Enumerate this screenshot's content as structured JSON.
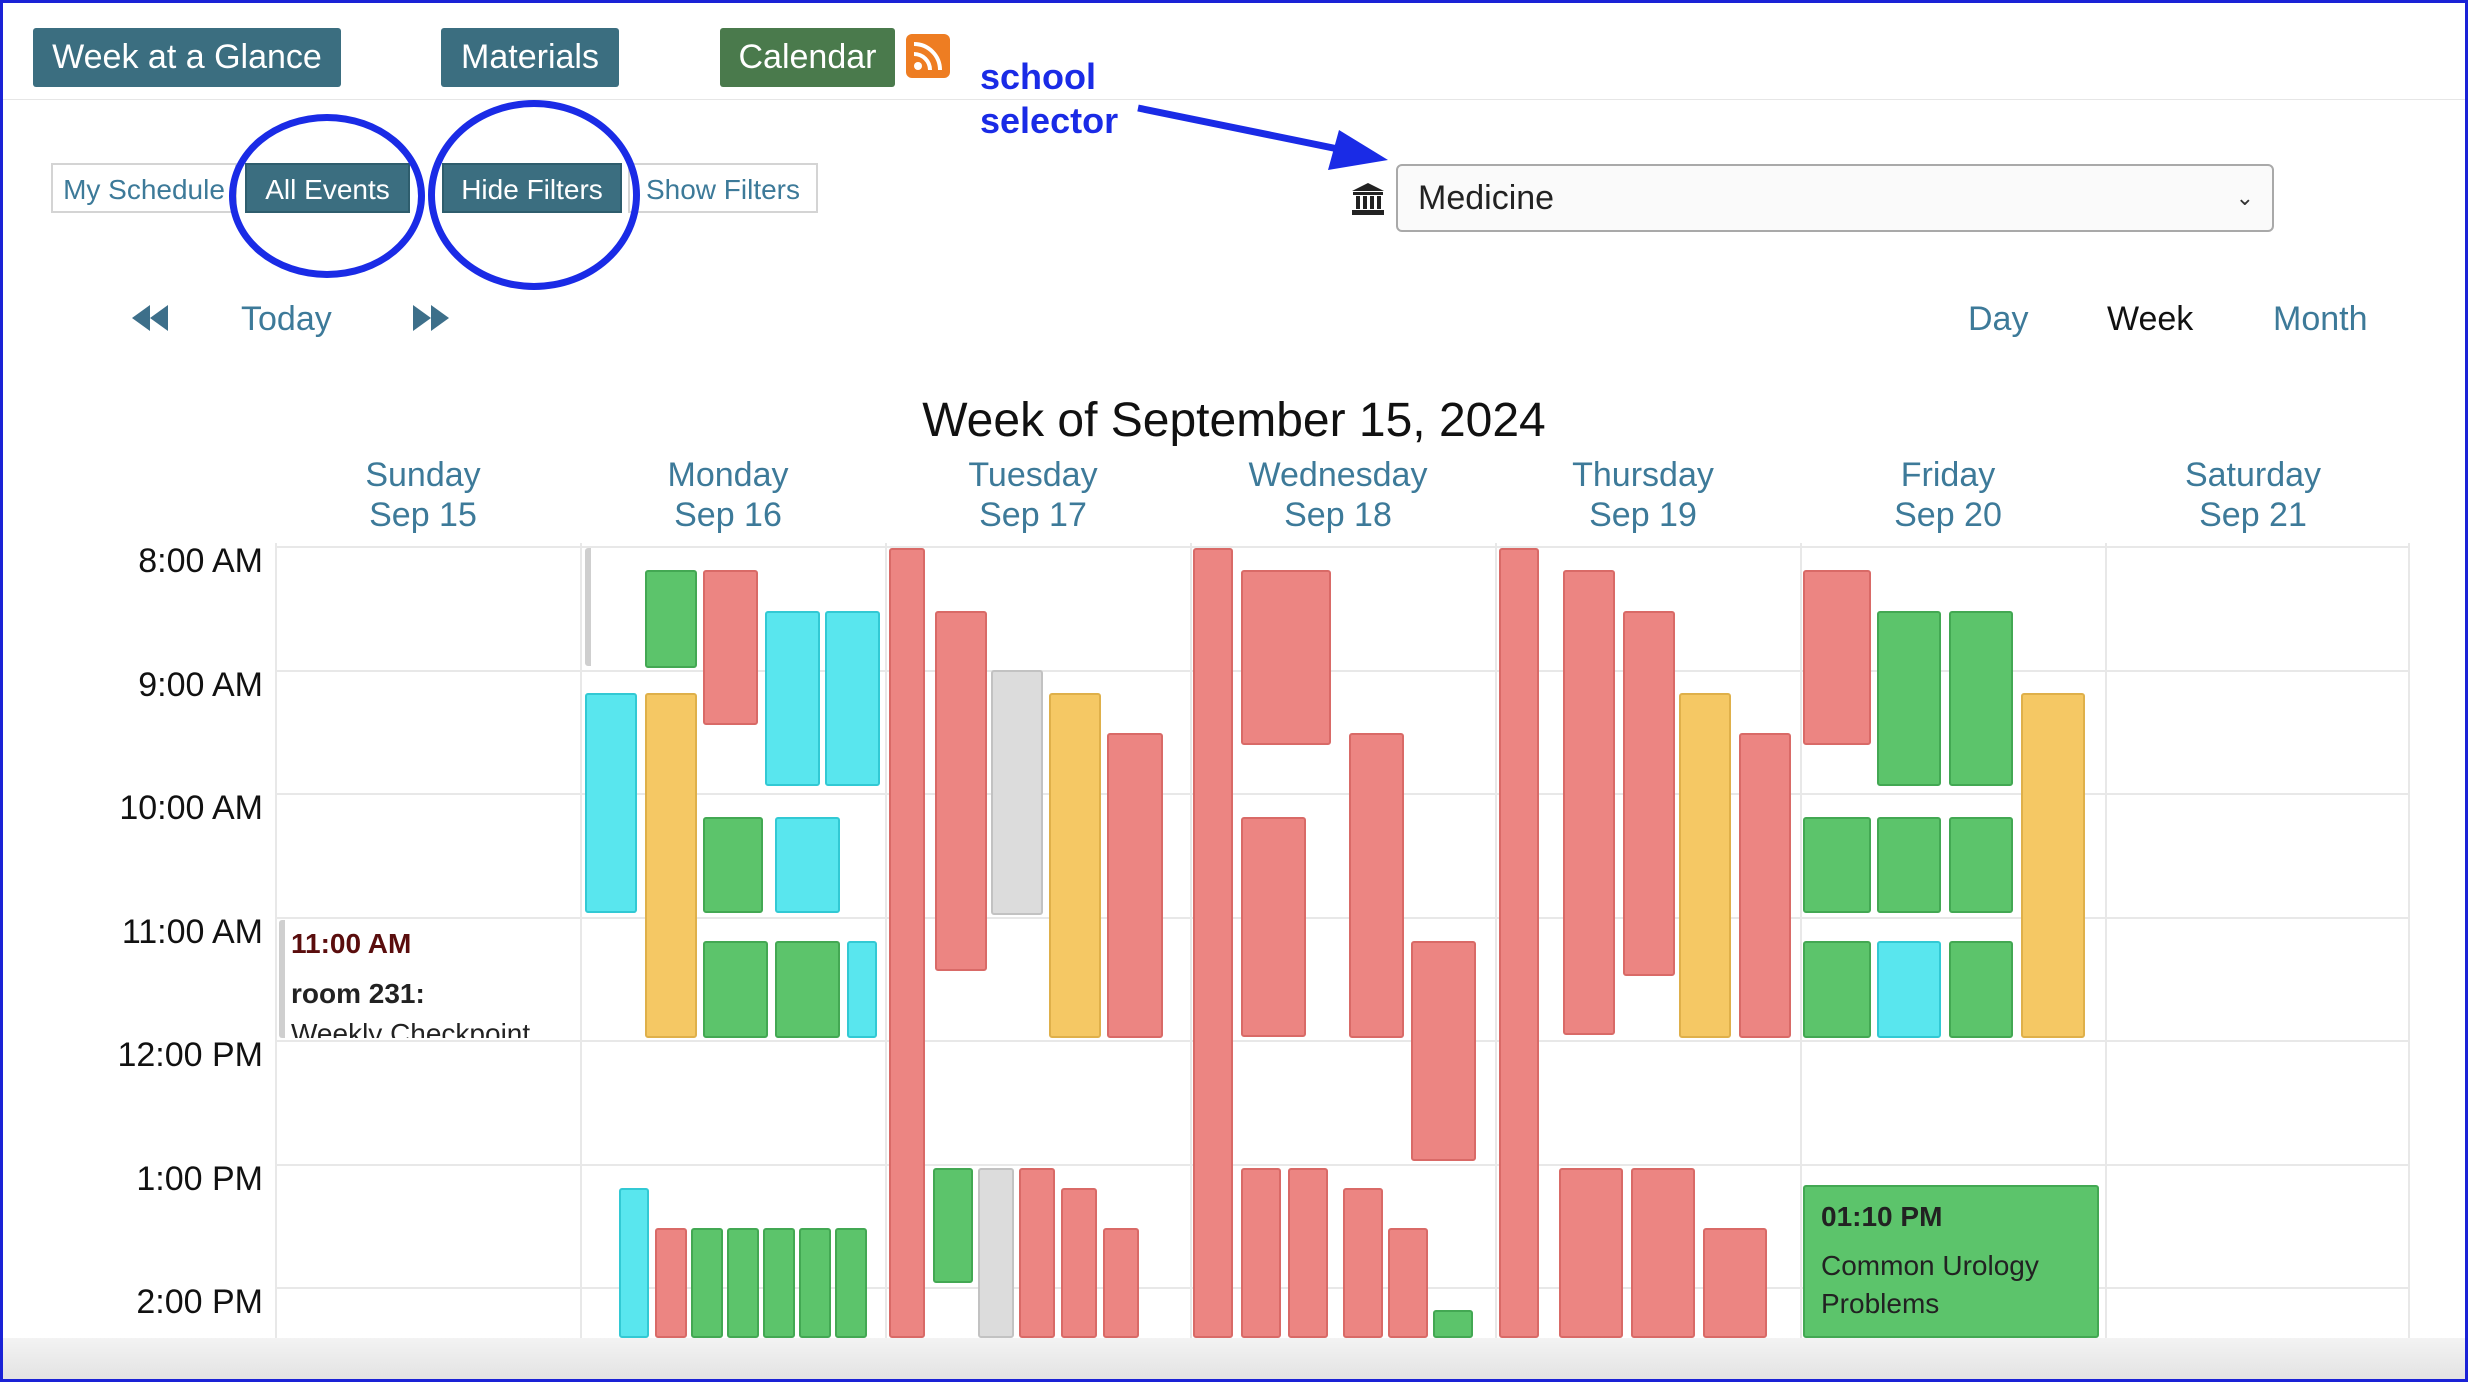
{
  "nav": {
    "week_at_glance": "Week at a Glance",
    "materials": "Materials",
    "calendar": "Calendar",
    "colors": {
      "week": "#3b6e80",
      "materials": "#3b6e80",
      "calendar": "#4a7a4c",
      "rss": "#ee7d22"
    }
  },
  "annotation": {
    "line1": "school",
    "line2": "selector",
    "color": "#1a2be6"
  },
  "view_toggle": {
    "my_schedule": "My Schedule",
    "all_events": "All Events"
  },
  "filters": {
    "hide": "Hide Filters",
    "show": "Show Filters"
  },
  "school_select": {
    "value": "Medicine"
  },
  "calendar_nav": {
    "today": "Today",
    "day": "Day",
    "week": "Week",
    "month": "Month"
  },
  "week_title": "Week of September 15, 2024",
  "days": [
    {
      "name": "Sunday",
      "date": "Sep 15"
    },
    {
      "name": "Monday",
      "date": "Sep 16"
    },
    {
      "name": "Tuesday",
      "date": "Sep 17"
    },
    {
      "name": "Wednesday",
      "date": "Sep 18"
    },
    {
      "name": "Thursday",
      "date": "Sep 19"
    },
    {
      "name": "Friday",
      "date": "Sep 20"
    },
    {
      "name": "Saturday",
      "date": "Sep 21"
    }
  ],
  "times": [
    "8:00 AM",
    "9:00 AM",
    "10:00 AM",
    "11:00 AM",
    "12:00 PM",
    "1:00 PM",
    "2:00 PM"
  ],
  "sunday_event": {
    "time": "11:00 AM",
    "room": "room 231:",
    "title": "Weekly Checkpoint"
  },
  "friday_event": {
    "time": "01:10 PM",
    "title": "Common Urology Problems"
  },
  "event_colors": {
    "red": "#ec8582",
    "green": "#5cc46b",
    "cyan": "#59e6ee",
    "yellow": "#f5c864",
    "gray": "#dcdcdc"
  }
}
